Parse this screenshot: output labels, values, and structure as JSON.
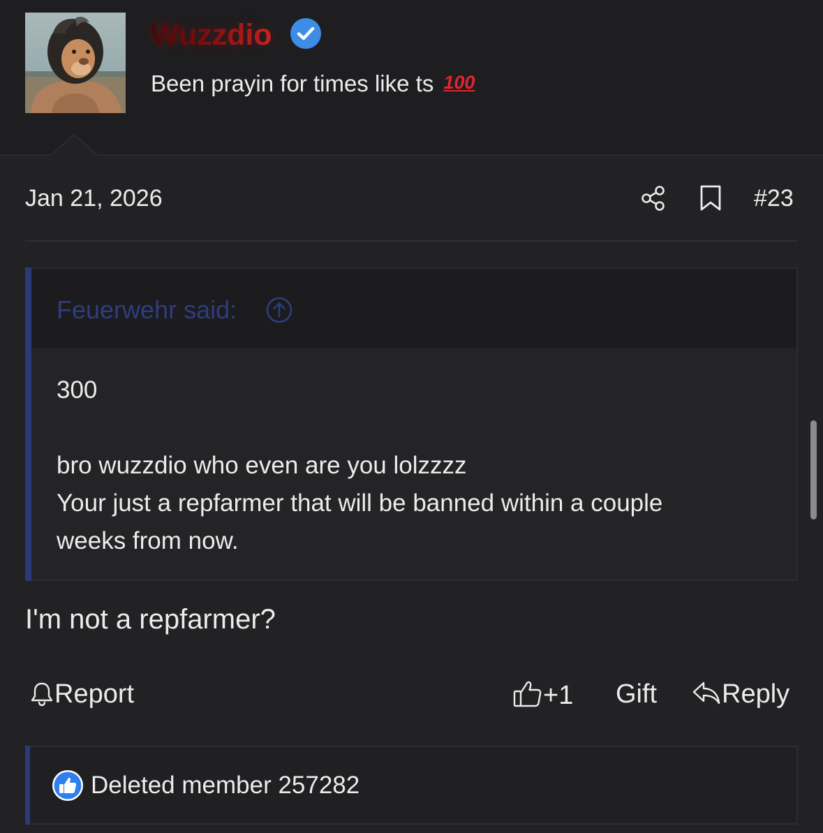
{
  "author": {
    "username": "Wuzzdio",
    "title": "Been prayin for times like ts",
    "title_emoji": "100",
    "verified_icon": "verified-check-icon",
    "avatar": "lion-avatar"
  },
  "post": {
    "date": "Jan 21, 2026",
    "number": "#23",
    "icons": [
      "share-icon",
      "bookmark-icon"
    ]
  },
  "quote": {
    "author_label": "Feuerwehr said:",
    "lines": [
      "300",
      "",
      "bro wuzzdio who even are you lolzzzz",
      "Your just a repfarmer that will be banned within a couple",
      "weeks from now."
    ]
  },
  "message": {
    "text": "I'm not a repfarmer?"
  },
  "actions": {
    "report": "Report",
    "like_count": "+1",
    "gift": "Gift",
    "reply": "Reply"
  },
  "reactions": {
    "member": "Deleted member 257282",
    "icon": "thumbs-up-icon"
  },
  "colors": {
    "background": "#1c1c1e",
    "post_background": "#222224",
    "quote_accent": "#2c3a78",
    "quote_author": "#2e3d7e",
    "username_gradient_end": "#d22424",
    "verified": "#3d8ce6",
    "emoji_red": "#e0262e",
    "text": "#ececec"
  }
}
